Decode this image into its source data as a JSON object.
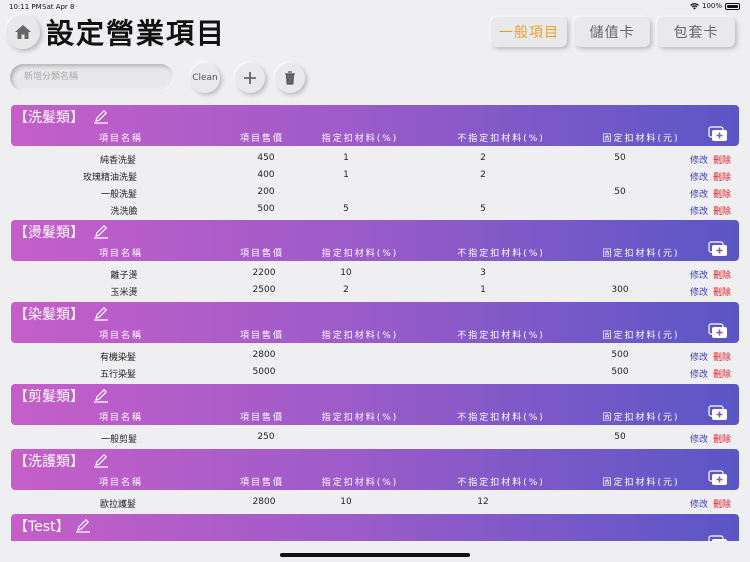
{
  "status": {
    "time": "10:11 PM",
    "date": "Sat Apr 8",
    "battery": "100%"
  },
  "title": "設定營業項目",
  "tabs": [
    "一般項目",
    "儲值卡",
    "包套卡"
  ],
  "search": {
    "placeholder": "新增分類名稱"
  },
  "toolbar": {
    "clean": "Clean"
  },
  "columns": [
    "項目名稱",
    "項目售價",
    "指定扣材料(%)",
    "不指定扣材料(%)",
    "固定扣材料(元)"
  ],
  "actions": {
    "edit": "修改",
    "delete": "刪除"
  },
  "categories": [
    {
      "name": "【洗髮類】",
      "items": [
        {
          "name": "純香洗髮",
          "price": "450",
          "designated": "1",
          "undesignated": "2",
          "fixed": "50"
        },
        {
          "name": "玫瑰精油洗髮",
          "price": "400",
          "designated": "1",
          "undesignated": "2",
          "fixed": ""
        },
        {
          "name": "一般洗髮",
          "price": "200",
          "designated": "",
          "undesignated": "",
          "fixed": "50"
        },
        {
          "name": "洗洗臉",
          "price": "500",
          "designated": "5",
          "undesignated": "5",
          "fixed": ""
        }
      ]
    },
    {
      "name": "【燙髮類】",
      "items": [
        {
          "name": "離子燙",
          "price": "2200",
          "designated": "10",
          "undesignated": "3",
          "fixed": ""
        },
        {
          "name": "玉米燙",
          "price": "2500",
          "designated": "2",
          "undesignated": "1",
          "fixed": "300"
        }
      ]
    },
    {
      "name": "【染髮類】",
      "items": [
        {
          "name": "有機染髮",
          "price": "2800",
          "designated": "",
          "undesignated": "",
          "fixed": "500"
        },
        {
          "name": "五行染髮",
          "price": "5000",
          "designated": "",
          "undesignated": "",
          "fixed": "500"
        }
      ]
    },
    {
      "name": "【剪髮類】",
      "items": [
        {
          "name": "一般剪髮",
          "price": "250",
          "designated": "",
          "undesignated": "",
          "fixed": "50"
        }
      ]
    },
    {
      "name": "【洗護類】",
      "items": [
        {
          "name": "歐拉護髮",
          "price": "2800",
          "designated": "10",
          "undesignated": "12",
          "fixed": ""
        }
      ]
    },
    {
      "name": "【Test】",
      "items": []
    }
  ]
}
